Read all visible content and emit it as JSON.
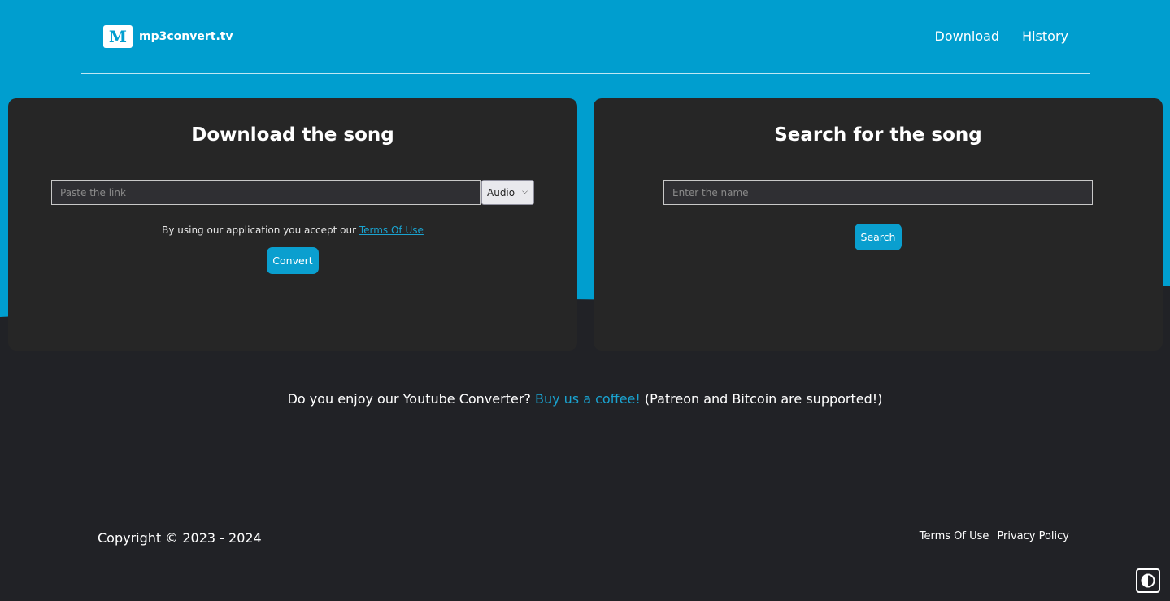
{
  "brand": {
    "name": "mp3convert.tv",
    "logo_icon": "mp3-logo-icon"
  },
  "nav": {
    "download_label": "Download",
    "history_label": "History"
  },
  "download_card": {
    "title": "Download the song",
    "link_placeholder": "Paste the link",
    "format_selected": "Audio",
    "terms_prefix": "By using our application you accept our ",
    "terms_link": "Terms Of Use",
    "convert_label": "Convert"
  },
  "search_card": {
    "title": "Search for the song",
    "name_placeholder": "Enter the name",
    "search_label": "Search"
  },
  "promo": {
    "prefix": "Do you enjoy our Youtube Converter? ",
    "link": "Buy us a coffee!",
    "suffix": " (Patreon and Bitcoin are supported!)"
  },
  "footer": {
    "copyright": "Copyright © 2023 - 2024",
    "terms_link": "Terms Of Use",
    "privacy_link": "Privacy Policy"
  },
  "colors": {
    "accent": "#009ecf",
    "background": "#212226",
    "card": "#262626"
  },
  "icons": {
    "theme_toggle": "contrast-icon",
    "select_chevron": "chevron-down-icon"
  }
}
